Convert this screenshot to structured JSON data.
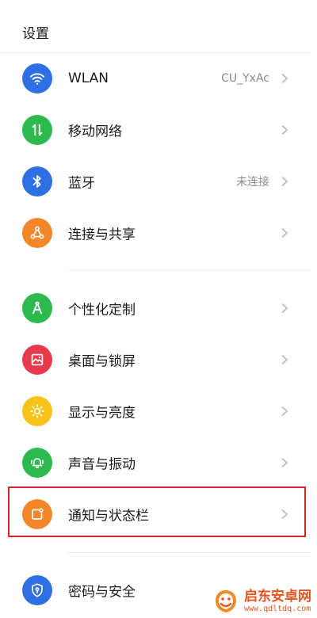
{
  "header": {
    "title": "设置"
  },
  "items": [
    {
      "label": "WLAN",
      "value": "CU_YxAc",
      "icon": "wifi-icon",
      "color": "#2f6fe4"
    },
    {
      "label": "移动网络",
      "value": "",
      "icon": "mobile-data-icon",
      "color": "#2db94d"
    },
    {
      "label": "蓝牙",
      "value": "未连接",
      "icon": "bluetooth-icon",
      "color": "#2f6fe4"
    },
    {
      "label": "连接与共享",
      "value": "",
      "icon": "share-icon",
      "color": "#f4862a"
    },
    {
      "label": "个性化定制",
      "value": "",
      "icon": "personalize-icon",
      "color": "#2db94d"
    },
    {
      "label": "桌面与锁屏",
      "value": "",
      "icon": "wallpaper-icon",
      "color": "#e8394d"
    },
    {
      "label": "显示与亮度",
      "value": "",
      "icon": "brightness-icon",
      "color": "#f7c31a"
    },
    {
      "label": "声音与振动",
      "value": "",
      "icon": "bell-icon",
      "color": "#2db94d"
    },
    {
      "label": "通知与状态栏",
      "value": "",
      "icon": "notification-icon",
      "color": "#f4862a"
    },
    {
      "label": "密码与安全",
      "value": "",
      "icon": "shield-icon",
      "color": "#2f6fe4"
    }
  ],
  "highlight_color": "#d6252b",
  "watermark": {
    "name": "启东安卓网",
    "url": "www.qdltdq.com"
  }
}
